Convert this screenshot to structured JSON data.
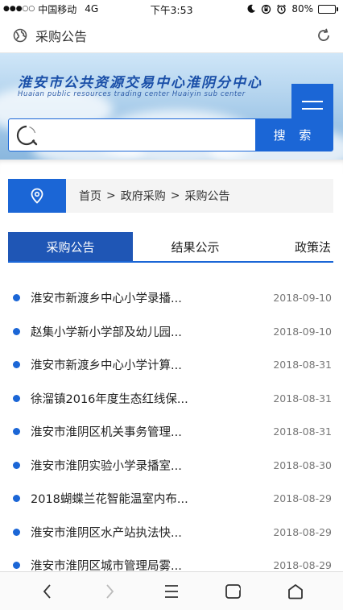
{
  "status_bar": {
    "signal": "●●●○○",
    "carrier": "中国移动",
    "network": "4G",
    "time": "下午3:53",
    "battery": "80%",
    "battery_level": 0.8
  },
  "nav": {
    "title": "采购公告",
    "globe_icon": "globe-icon",
    "refresh_icon": "refresh-icon"
  },
  "banner": {
    "title": "淮安市公共资源交易中心淮阴分中心",
    "subtitle": "Huaian public resources trading center Huaiyin sub center",
    "search_placeholder": "",
    "search_button": "搜 索"
  },
  "breadcrumb": {
    "items": [
      "首页",
      "政府采购",
      "采购公告"
    ],
    "separator": ">"
  },
  "tabs": [
    {
      "label": "采购公告",
      "active": true
    },
    {
      "label": "结果公示",
      "active": false
    },
    {
      "label": "政策法",
      "active": false
    }
  ],
  "list": [
    {
      "title": "淮安市新渡乡中心小学录播...",
      "date": "2018-09-10"
    },
    {
      "title": "赵集小学新小学部及幼儿园...",
      "date": "2018-09-10"
    },
    {
      "title": "淮安市新渡乡中心小学计算...",
      "date": "2018-08-31"
    },
    {
      "title": "徐溜镇2016年度生态红线保...",
      "date": "2018-08-31"
    },
    {
      "title": "淮安市淮阴区机关事务管理...",
      "date": "2018-08-31"
    },
    {
      "title": "淮安市淮阴实验小学录播室...",
      "date": "2018-08-30"
    },
    {
      "title": "2018蝴蝶兰花智能温室内布...",
      "date": "2018-08-29"
    },
    {
      "title": "淮安市淮阴区水产站执法快...",
      "date": "2018-08-29"
    },
    {
      "title": "淮安市淮阴区城市管理局雾...",
      "date": "2018-08-29"
    }
  ],
  "colors": {
    "accent": "#1b66d6",
    "tab_active": "#1f56b5"
  }
}
